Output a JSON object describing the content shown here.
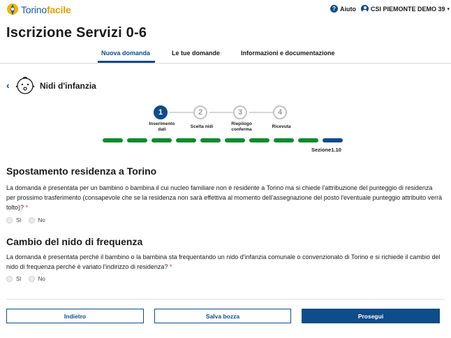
{
  "header": {
    "logo_text_light": "Torino",
    "logo_text_bold": "facile",
    "help_label": "Aiuto",
    "user_label": "CSI PIEMONTE DEMO 39",
    "user_caret": "▾"
  },
  "page": {
    "title": "Iscrizione Servizi 0-6"
  },
  "tabs": [
    {
      "label": "Nuova domanda",
      "active": true
    },
    {
      "label": "Le tue domande",
      "active": false
    },
    {
      "label": "Informazioni e documentazione",
      "active": false
    }
  ],
  "section": {
    "back_icon": "chevron-left-icon",
    "icon": "baby-icon",
    "name": "Nidi d'infanzia"
  },
  "stepper": {
    "steps": [
      {
        "number": "1",
        "label_line1": "Inserimento",
        "label_line2": "dati",
        "active": true
      },
      {
        "number": "2",
        "label_line1": "Scelta nidi",
        "label_line2": "",
        "active": false
      },
      {
        "number": "3",
        "label_line1": "Riepilogo",
        "label_line2": "conferma",
        "active": false
      },
      {
        "number": "4",
        "label_line1": "Ricevuta",
        "label_line2": "",
        "active": false
      }
    ]
  },
  "progress": {
    "segments_total": 10,
    "segments_completed": 9,
    "current_segment": 10,
    "label": "Sezione1.10",
    "completed_color": "#0a8c2c",
    "current_color": "#0f4c8a"
  },
  "questions": [
    {
      "title": "Spostamento residenza a Torino",
      "text": "La domanda è presentata per un bambino o bambina il cui nucleo familiare non è residente a Torino ma si chiede l'attribuzione del punteggio di residenza per prossimo trasferimento (consapevole che se la residenza non sarà effettiva al momento dell'assegnazione del posto l'eventuale punteggio attribuito verrà tolto)?",
      "required_mark": "*",
      "options": [
        "Sì",
        "No"
      ]
    },
    {
      "title": "Cambio del nido di frequenza",
      "text": "La domanda è presentata perché il bambino o la bambina sta frequentando un nido d'infanzia comunale o convenzionato di Torino e si richiede il cambio del nido di frequenza perché è variato l'indirizzo di residenza?",
      "required_mark": "*",
      "options": [
        "Sì",
        "No"
      ]
    }
  ],
  "buttons": {
    "back": "Indietro",
    "save_draft": "Salva bozza",
    "next": "Prosegui"
  },
  "colors": {
    "primary": "#0f4c8a",
    "success": "#0a8c2c",
    "required": "#d12b2b",
    "logo_accent": "#e0a100"
  }
}
